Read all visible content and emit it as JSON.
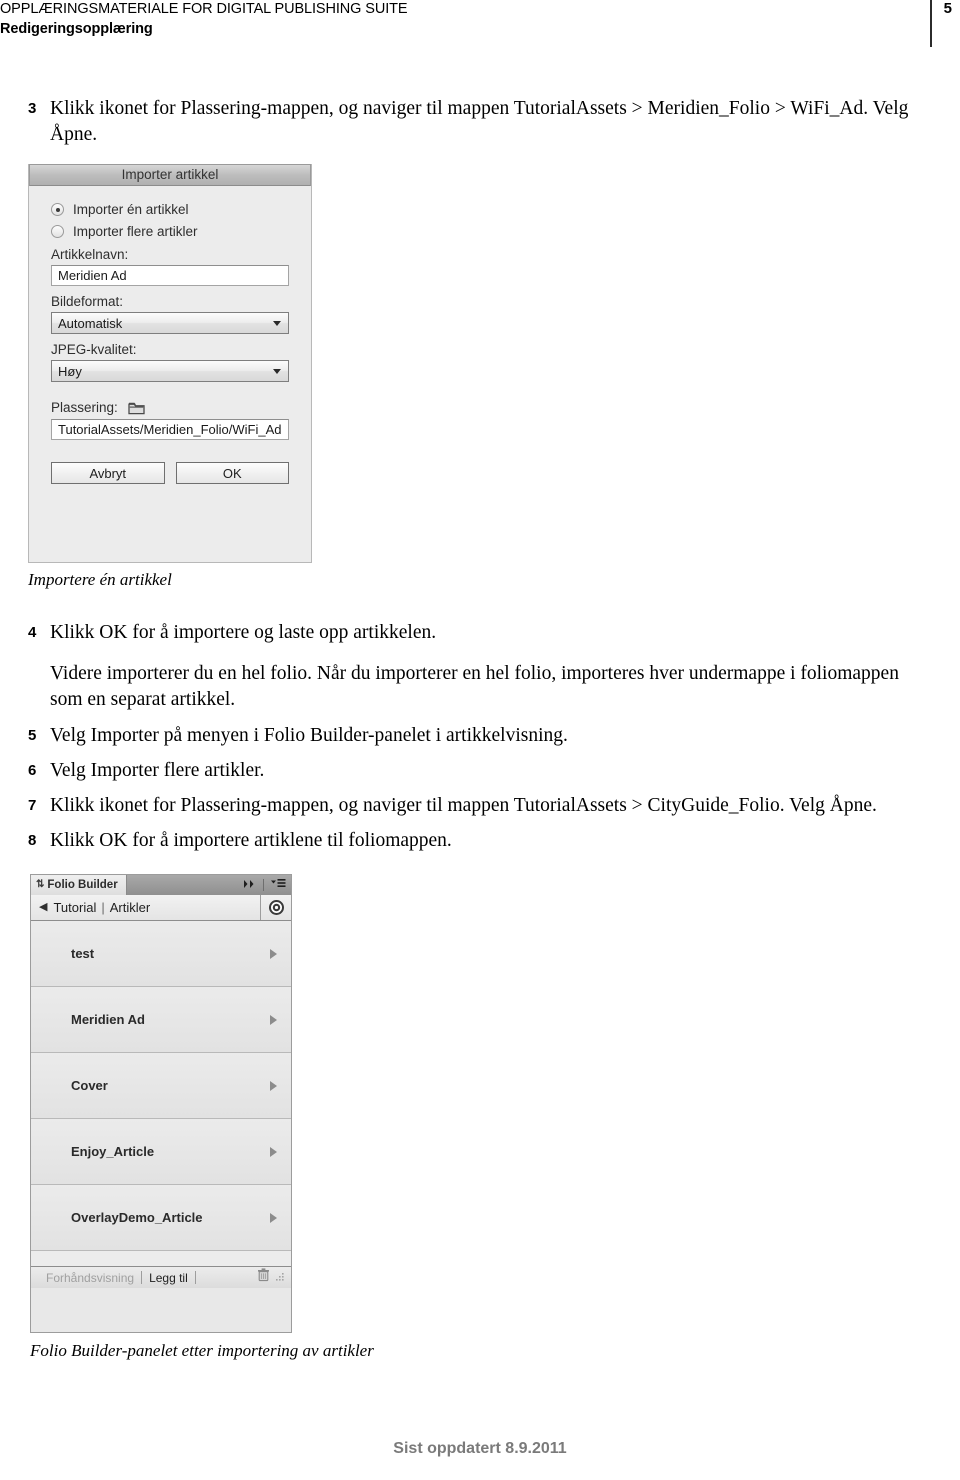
{
  "header": {
    "line1": "OPPLÆRINGSMATERIALE FOR DIGITAL PUBLISHING SUITE",
    "line2": "Redigeringsopplæring",
    "page_number": "5"
  },
  "steps": {
    "s3_num": "3",
    "s3_text": "Klikk ikonet for Plassering-mappen, og naviger til mappen TutorialAssets > Meridien_Folio > WiFi_Ad. Velg Åpne.",
    "s4_num": "4",
    "s4_text": "Klikk OK for å importere og laste opp artikkelen.",
    "s4_para": "Videre importerer du en hel folio. Når du importerer en hel folio, importeres hver undermappe i foliomappen som en separat artikkel.",
    "s5_num": "5",
    "s5_text": "Velg Importer på menyen i Folio Builder-panelet i artikkelvisning.",
    "s6_num": "6",
    "s6_text": "Velg Importer flere artikler.",
    "s7_num": "7",
    "s7_text": "Klikk ikonet for Plassering-mappen, og naviger til mappen TutorialAssets > CityGuide_Folio. Velg Åpne.",
    "s8_num": "8",
    "s8_text": "Klikk OK for å importere artiklene til foliomappen."
  },
  "captions": {
    "dialog": "Importere én artikkel",
    "panel": "Folio Builder-panelet etter importering av artikler"
  },
  "dialog": {
    "title": "Importer artikkel",
    "radio_single": "Importer én artikkel",
    "radio_multiple": "Importer flere artikler",
    "label_name": "Artikkelnavn:",
    "value_name": "Meridien Ad",
    "label_format": "Bildeformat:",
    "value_format": "Automatisk",
    "label_quality": "JPEG-kvalitet:",
    "value_quality": "Høy",
    "label_location": "Plassering:",
    "value_location": "TutorialAssets/Meridien_Folio/WiFi_Ad",
    "btn_cancel": "Avbryt",
    "btn_ok": "OK"
  },
  "panel": {
    "tab_label": "Folio Builder",
    "crumb_parent": "Tutorial",
    "crumb_sep": "|",
    "crumb_current": "Artikler",
    "items": [
      {
        "label": "test"
      },
      {
        "label": "Meridien Ad"
      },
      {
        "label": "Cover"
      },
      {
        "label": "Enjoy_Article"
      },
      {
        "label": "OverlayDemo_Article"
      }
    ],
    "footer_preview": "Forhåndsvisning",
    "footer_add": "Legg til"
  },
  "footer": {
    "updated": "Sist oppdatert 8.9.2011"
  },
  "colors": {
    "page_bg": "#ffffff",
    "text": "#000000",
    "footer_text": "#7a7a7a",
    "chrome_bg": "#e8e8e8"
  }
}
